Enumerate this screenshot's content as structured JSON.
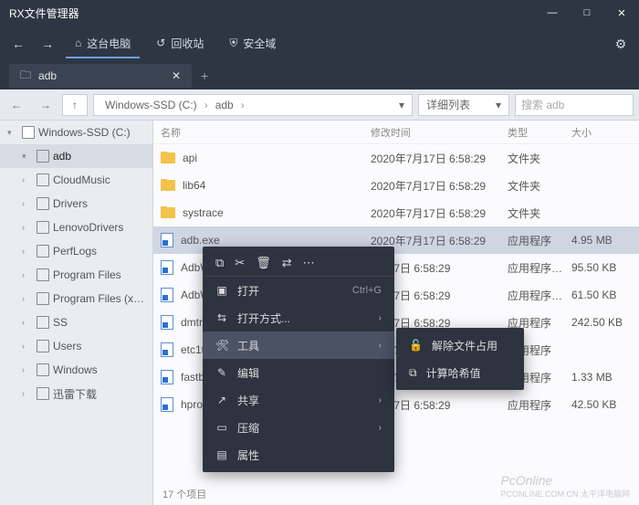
{
  "app": {
    "title": "RX文件管理器"
  },
  "window": {
    "min": "—",
    "max": "□",
    "close": "✕"
  },
  "header": {
    "back": "←",
    "fwd": "→",
    "tabs": [
      {
        "icon": "⌂",
        "label": "这台电脑"
      },
      {
        "icon": "↺",
        "label": "回收站"
      },
      {
        "icon": "⛨",
        "label": "安全域"
      }
    ],
    "gear": "⚙"
  },
  "filetab": {
    "icon": "🗀",
    "label": "adb",
    "close": "✕",
    "add": "+"
  },
  "toolbar": {
    "back": "←",
    "fwd": "→",
    "up": "↑",
    "crumbs": [
      "Windows-SSD (C:)",
      "adb"
    ],
    "sep": "›",
    "dropdown": "▾",
    "view": "详细列表",
    "search_placeholder": "搜索 adb"
  },
  "sidebar": {
    "root": {
      "label": "Windows-SSD (C:)"
    },
    "items": [
      {
        "label": "adb",
        "selected": true
      },
      {
        "label": "CloudMusic"
      },
      {
        "label": "Drivers"
      },
      {
        "label": "LenovoDrivers"
      },
      {
        "label": "PerfLogs"
      },
      {
        "label": "Program Files"
      },
      {
        "label": "Program Files (x…"
      },
      {
        "label": "SS"
      },
      {
        "label": "Users"
      },
      {
        "label": "Windows"
      },
      {
        "label": "迅雷下载"
      }
    ]
  },
  "columns": {
    "name": "名称",
    "date": "修改时间",
    "type": "类型",
    "size": "大小"
  },
  "rows": [
    {
      "icon": "folder",
      "name": "api",
      "date": "2020年7月17日 6:58:29",
      "type": "文件夹",
      "size": ""
    },
    {
      "icon": "folder",
      "name": "lib64",
      "date": "2020年7月17日 6:58:29",
      "type": "文件夹",
      "size": ""
    },
    {
      "icon": "folder",
      "name": "systrace",
      "date": "2020年7月17日 6:58:29",
      "type": "文件夹",
      "size": ""
    },
    {
      "icon": "exe",
      "name": "adb.exe",
      "date": "2020年7月17日 6:58:29",
      "type": "应用程序",
      "size": "4.95 MB",
      "selected": true
    },
    {
      "icon": "exe",
      "name": "AdbWinApi.dll",
      "date": "7月17日 6:58:29",
      "type": "应用程序…",
      "size": "95.50 KB"
    },
    {
      "icon": "exe",
      "name": "AdbWinUsbApi.dll",
      "date": "7月17日 6:58:29",
      "type": "应用程序…",
      "size": "61.50 KB"
    },
    {
      "icon": "exe",
      "name": "dmtracedump.exe",
      "date": "7月17日 6:58:29",
      "type": "应用程序",
      "size": "242.50 KB"
    },
    {
      "icon": "exe",
      "name": "etc1tool.exe",
      "date": "7月17日 6:58:29",
      "type": "应用程序",
      "size": ""
    },
    {
      "icon": "exe",
      "name": "fastboot.exe",
      "date": "7月17日 6:58:29",
      "type": "应用程序",
      "size": "1.33 MB"
    },
    {
      "icon": "exe",
      "name": "hprof-conv.exe",
      "date": "7月17日 6:58:29",
      "type": "应用程序",
      "size": "42.50 KB"
    }
  ],
  "footer": {
    "count": "17 个项目"
  },
  "context": {
    "icons": [
      "⧉",
      "✂",
      "🗑",
      "⇄",
      "⋯"
    ],
    "items": [
      {
        "icon": "▣",
        "label": "打开",
        "shortcut": "Ctrl+G"
      },
      {
        "icon": "⇆",
        "label": "打开方式...",
        "sub": "›"
      },
      {
        "icon": "🛠",
        "label": "工具",
        "sub": "›",
        "hover": true
      },
      {
        "icon": "✎",
        "label": "编辑"
      },
      {
        "icon": "↗",
        "label": "共享",
        "sub": "›"
      },
      {
        "icon": "▭",
        "label": "压缩",
        "sub": "›"
      },
      {
        "icon": "▤",
        "label": "属性"
      }
    ]
  },
  "submenu": {
    "items": [
      {
        "icon": "🔓",
        "label": "解除文件占用"
      },
      {
        "icon": "⧉",
        "label": "计算哈希值"
      }
    ]
  },
  "watermark": {
    "brand": "PcOnline",
    "sub": "PCONLINE.COM.CN 太平洋电脑网"
  }
}
